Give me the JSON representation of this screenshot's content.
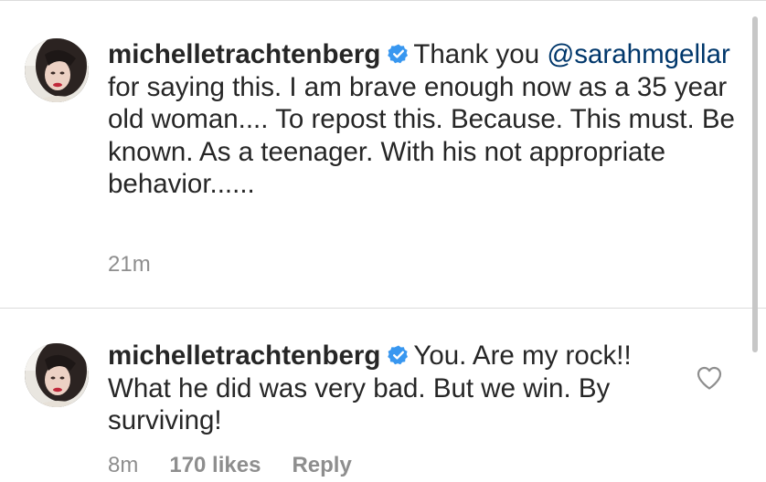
{
  "comments": [
    {
      "username": "michelletrachtenberg",
      "verified": true,
      "text_before_mention": "Thank you ",
      "mention": "@sarahmgellar",
      "text_after_mention": " for saying this. I am brave enough now as a 35 year old woman.... To repost this. Because.  This must. Be known. As a teenager. With his not appropriate behavior......",
      "time": "21m"
    },
    {
      "username": "michelletrachtenberg",
      "verified": true,
      "text": "You. Are my rock!! What he did was very bad. But we win. By surviving!",
      "time": "8m",
      "likes": "170 likes",
      "reply_label": "Reply"
    }
  ],
  "icons": {
    "verified": "verified-badge-icon",
    "like": "heart-outline-icon"
  },
  "colors": {
    "verified_blue": "#3897f0",
    "mention": "#00376b",
    "meta_gray": "#8e8e8e",
    "text": "#262626"
  }
}
